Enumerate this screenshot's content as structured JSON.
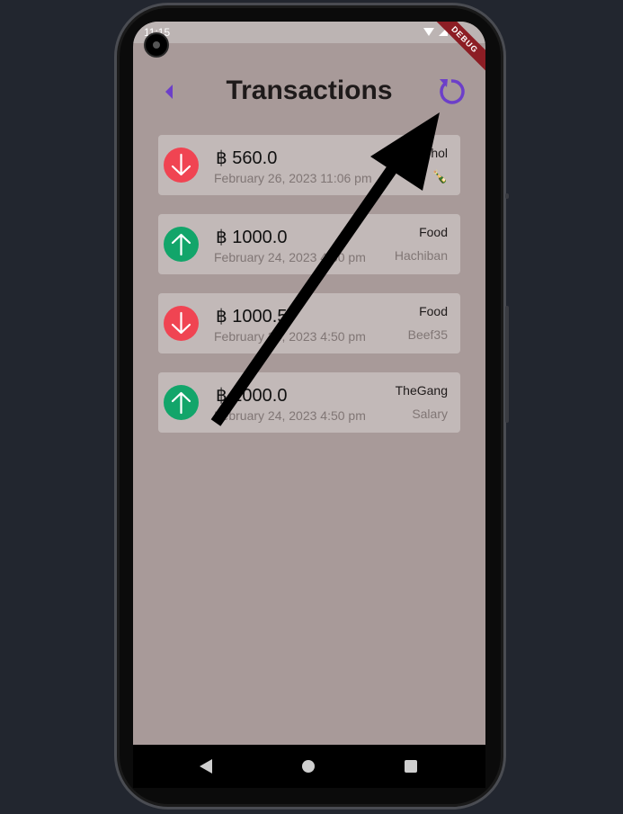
{
  "status_bar": {
    "time": "11:15",
    "debug_label": "DEBUG"
  },
  "header": {
    "title": "Transactions",
    "back_icon": "chevron-left-icon",
    "refresh_icon": "refresh-icon"
  },
  "colors": {
    "accent": "#6c3fc9",
    "expense": "#f04452",
    "income": "#12a56a",
    "background": "#a89a99",
    "card": "#c2b9b8"
  },
  "transactions": [
    {
      "direction": "down",
      "amount": "฿ 560.0",
      "date": "February 26, 2023 11:06 pm",
      "category": "Alcohol",
      "note": "🍾"
    },
    {
      "direction": "up",
      "amount": "฿ 1000.0",
      "date": "February 24, 2023 4:50 pm",
      "category": "Food",
      "note": "Hachiban"
    },
    {
      "direction": "down",
      "amount": "฿ 1000.5",
      "date": "February 24, 2023 4:50 pm",
      "category": "Food",
      "note": "Beef35"
    },
    {
      "direction": "up",
      "amount": "฿ 1000.0",
      "date": "February 24, 2023 4:50 pm",
      "category": "TheGang",
      "note": "Salary"
    }
  ]
}
